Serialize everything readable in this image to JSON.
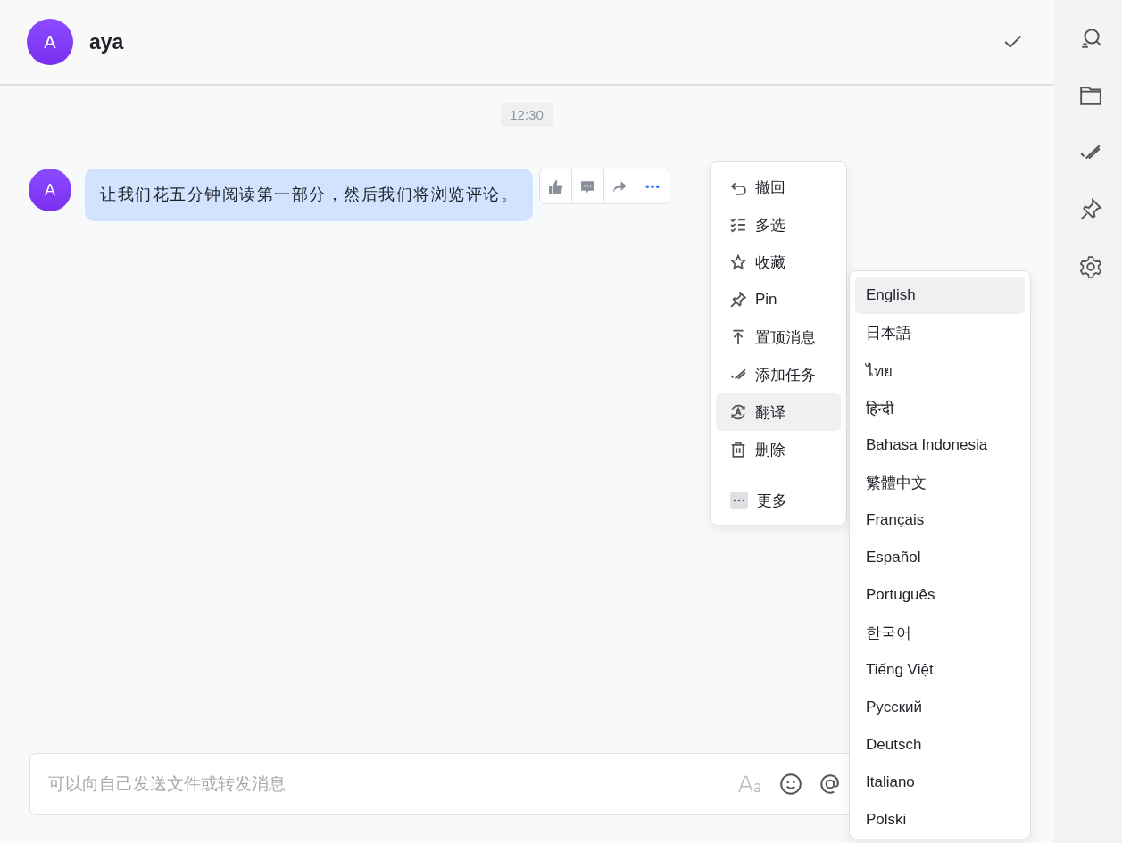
{
  "header": {
    "avatar": "A",
    "name": "aya"
  },
  "timestamp": "12:30",
  "message": {
    "avatar": "A",
    "text": "让我们花五分钟阅读第一部分，然后我们将浏览评论。"
  },
  "context_menu": {
    "items": [
      {
        "label": "撤回",
        "selected": false
      },
      {
        "label": "多选",
        "selected": false
      },
      {
        "label": "收藏",
        "selected": false
      },
      {
        "label": "Pin",
        "selected": false
      },
      {
        "label": "置顶消息",
        "selected": false
      },
      {
        "label": "添加任务",
        "selected": false
      },
      {
        "label": "翻译",
        "selected": true
      },
      {
        "label": "删除",
        "selected": false
      }
    ],
    "more": "更多"
  },
  "language_menu": {
    "items": [
      {
        "label": "English",
        "selected": true
      },
      {
        "label": "日本語",
        "selected": false
      },
      {
        "label": "ไทย",
        "selected": false
      },
      {
        "label": "हिन्दी",
        "selected": false
      },
      {
        "label": "Bahasa Indonesia",
        "selected": false
      },
      {
        "label": "繁體中文",
        "selected": false
      },
      {
        "label": "Français",
        "selected": false
      },
      {
        "label": "Español",
        "selected": false
      },
      {
        "label": "Português",
        "selected": false
      },
      {
        "label": "한국어",
        "selected": false
      },
      {
        "label": "Tiếng Việt",
        "selected": false
      },
      {
        "label": "Русский",
        "selected": false
      },
      {
        "label": "Deutsch",
        "selected": false
      },
      {
        "label": "Italiano",
        "selected": false
      },
      {
        "label": "Polski",
        "selected": false
      }
    ]
  },
  "composer": {
    "placeholder": "可以向自己发送文件或转发消息"
  }
}
